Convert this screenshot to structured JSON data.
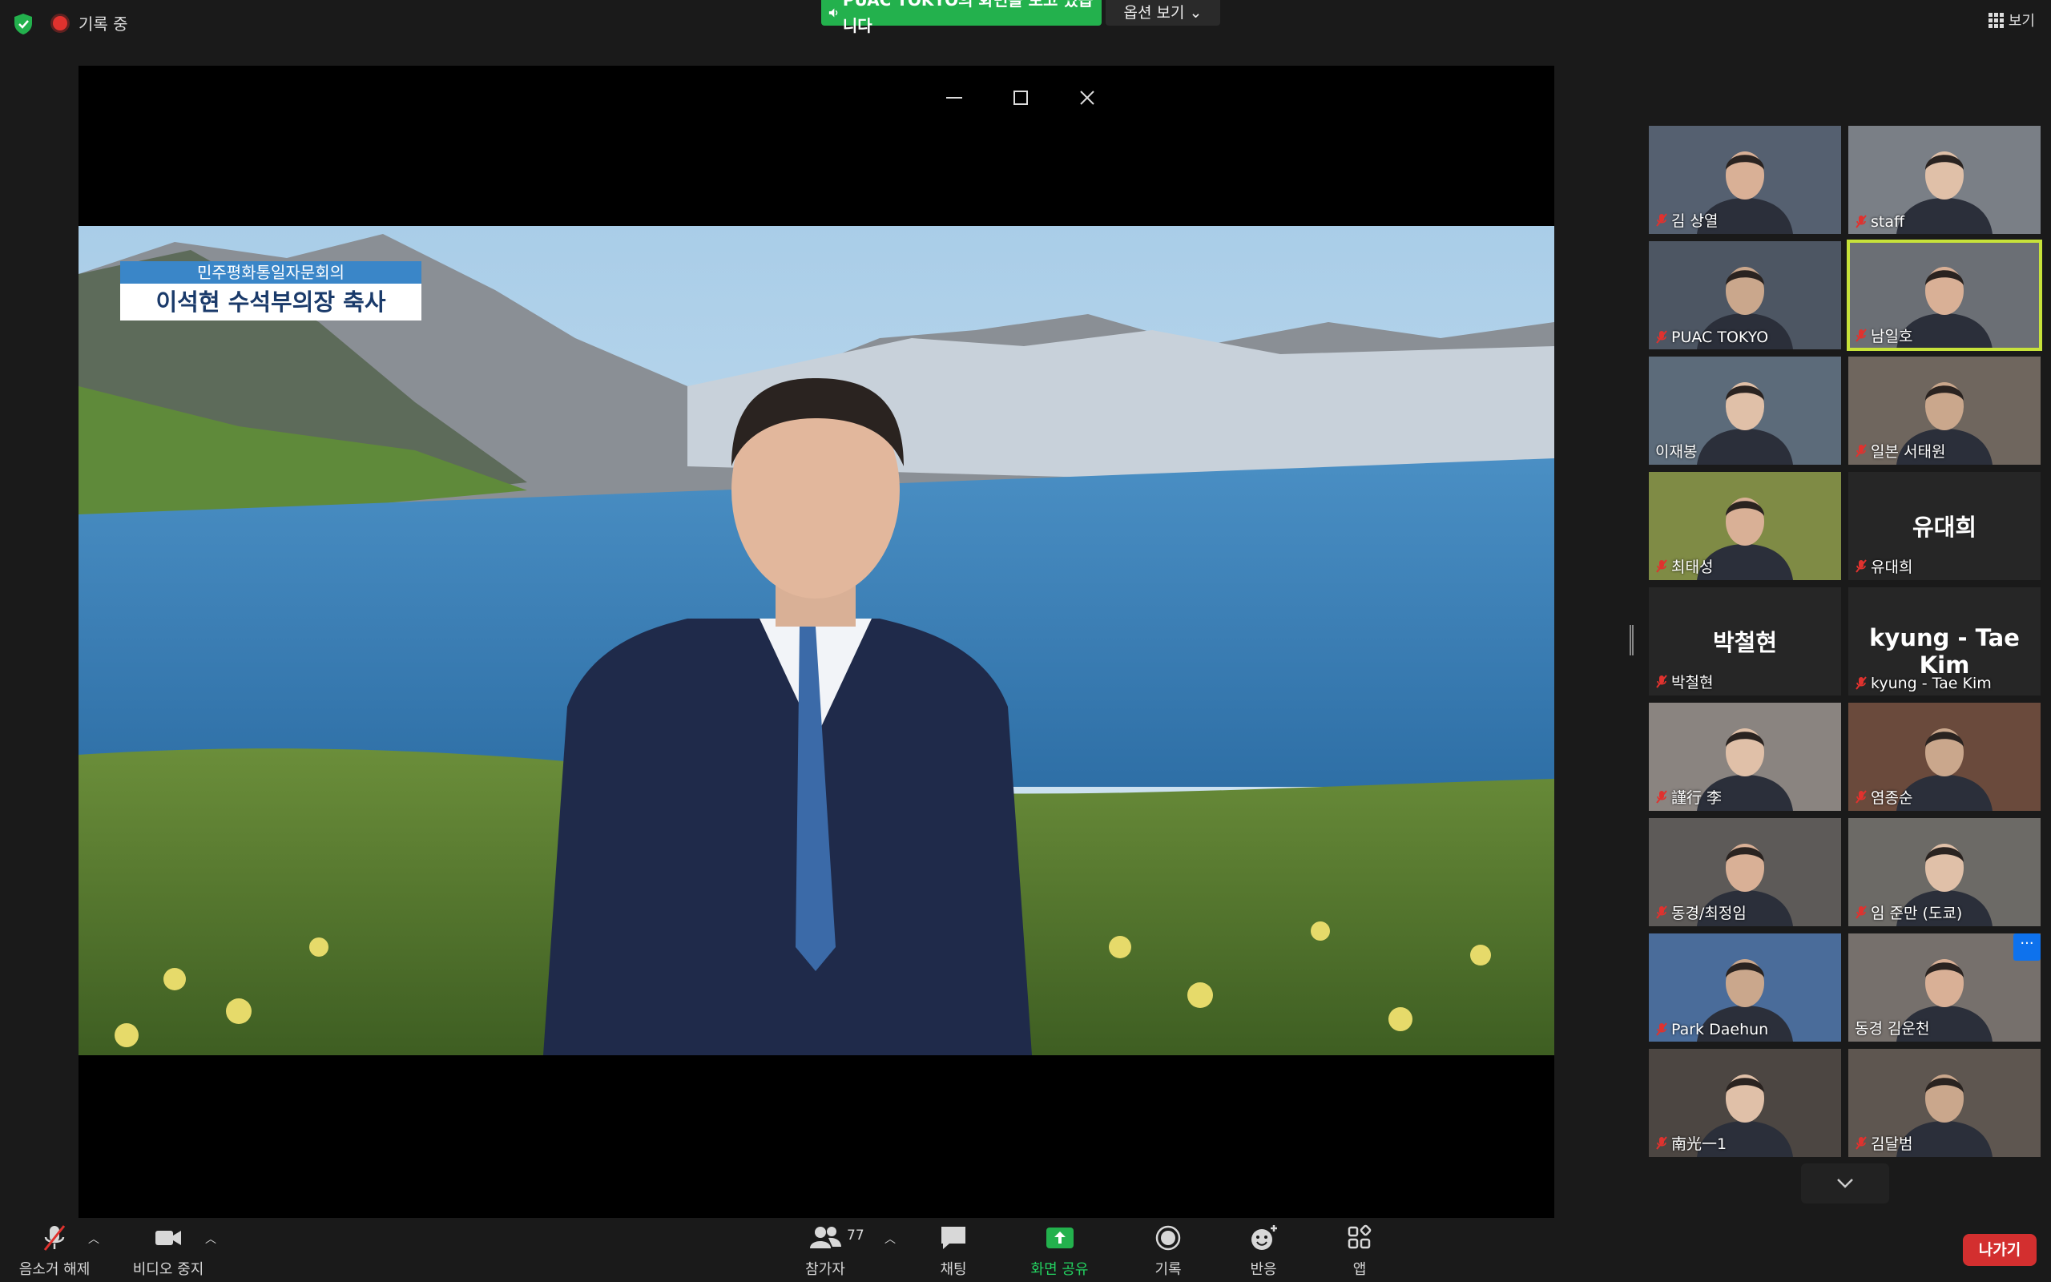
{
  "top": {
    "recording_label": "기록 중",
    "share_banner": "PUAC TOKYO의 화면을 보고 있습니다",
    "view_options": "옵션 보기 ⌄",
    "view_label": "보기"
  },
  "shared_screen": {
    "caption_org": "민주평화통일자문회의",
    "caption_title": "이석현 수석부의장 축사"
  },
  "gallery": {
    "tiles": [
      {
        "name": "김 상열",
        "muted": true
      },
      {
        "name": "staff",
        "muted": true
      },
      {
        "name": "PUAC TOKYO",
        "muted": true
      },
      {
        "name": "남일호",
        "muted": true,
        "active": true
      },
      {
        "name": "이재봉",
        "muted": false
      },
      {
        "name": "일본 서태원",
        "muted": true
      },
      {
        "name": "최태성",
        "muted": true
      },
      {
        "name": "유대희",
        "muted": true,
        "display_name": "유대희"
      },
      {
        "name": "박철현",
        "muted": true,
        "display_name": "박철현"
      },
      {
        "name": "kyung - Tae Kim",
        "muted": true,
        "display_name": "kyung - Tae Kim"
      },
      {
        "name": "謹行 李",
        "muted": true
      },
      {
        "name": "염종순",
        "muted": true
      },
      {
        "name": "동경/최정임",
        "muted": true
      },
      {
        "name": "임 준만 (도쿄)",
        "muted": true
      },
      {
        "name": "Park Daehun",
        "muted": true
      },
      {
        "name": "동경 김운천",
        "muted": false
      },
      {
        "name": "南光一1",
        "muted": true
      },
      {
        "name": "김달범",
        "muted": true
      }
    ],
    "more_label": "···"
  },
  "toolbar": {
    "unmute_label": "음소거 해제",
    "video_label": "비디오 중지",
    "participants_label": "참가자",
    "participants_count": "77",
    "chat_label": "채팅",
    "share_label": "화면 공유",
    "record_label": "기록",
    "reactions_label": "반응",
    "apps_label": "앱",
    "leave_label": "나가기"
  },
  "colors": {
    "share_green": "#23b14d",
    "leave_red": "#d32f2f",
    "active_speaker": "#c7e23a",
    "mute_red": "#e0322e"
  }
}
